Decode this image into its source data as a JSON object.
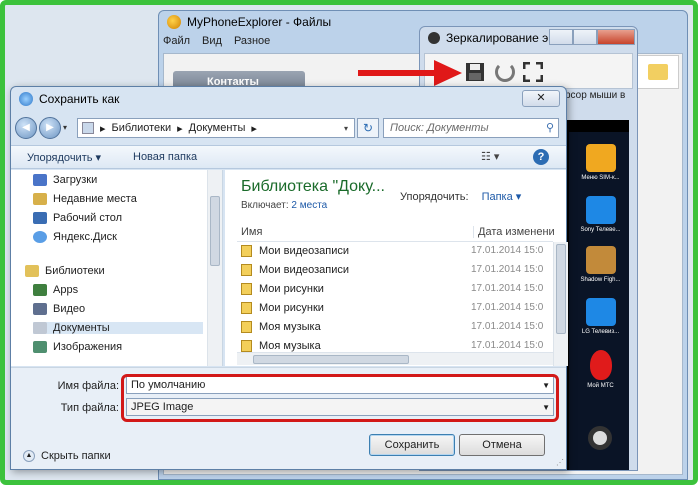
{
  "bg_window": {
    "title": "MyPhoneExplorer - Файлы",
    "menu": [
      "Файл",
      "Вид",
      "Разное"
    ],
    "contacts_button": "Контакты"
  },
  "mirror_window": {
    "title": "Зеркалирование э...",
    "cursor_text": "рсор мыши в",
    "phone_apps": [
      {
        "label": "Меню SIM-к...",
        "color": "#f0a820"
      },
      {
        "label": "Sony Телеве...",
        "color": "#1e88e5"
      },
      {
        "label": "Shadow Figh...",
        "color": "#c28a3a"
      },
      {
        "label": "LG Телевиз...",
        "color": "#1e88e5"
      },
      {
        "label": "Мой МТС",
        "color": "#e01b1b"
      }
    ]
  },
  "dialog": {
    "title": "Сохранить как",
    "close_label": "✕",
    "address": {
      "crumbs": [
        "Библиотеки",
        "Документы"
      ],
      "sep": "▸"
    },
    "search_placeholder": "Поиск: Документы",
    "commands": {
      "organize": "Упорядочить ▾",
      "new_folder": "Новая папка",
      "help": "?"
    },
    "nav_items": [
      {
        "label": "Загрузки",
        "color": "#4a74c8",
        "indent": false
      },
      {
        "label": "Недавние места",
        "color": "#d7b04a",
        "indent": false
      },
      {
        "label": "Рабочий стол",
        "color": "#3a6db3",
        "indent": false
      },
      {
        "label": "Яндекс.Диск",
        "color": "#5a9ee6",
        "indent": false
      },
      {
        "label": "Библиотеки",
        "color": "#e2c15a",
        "indent": true
      },
      {
        "label": "Apps",
        "color": "#3f7f3f",
        "indent": false
      },
      {
        "label": "Видео",
        "color": "#5f6f8f",
        "indent": false
      },
      {
        "label": "Документы",
        "color": "#c0c8d4",
        "indent": false,
        "selected": true
      },
      {
        "label": "Изображения",
        "color": "#4f8f6f",
        "indent": false
      }
    ],
    "library": {
      "title": "Библиотека \"Доку...",
      "includes_label": "Включает:",
      "includes_link": "2 места",
      "arrange_label": "Упорядочить:",
      "arrange_value": "Папка ▾"
    },
    "columns": {
      "name": "Имя",
      "date": "Дата изменени"
    },
    "files": [
      {
        "name": "Мои видеозаписи",
        "date": "17.01.2014 15:0"
      },
      {
        "name": "Мои видеозаписи",
        "date": "17.01.2014 15:0"
      },
      {
        "name": "Мои рисунки",
        "date": "17.01.2014 15:0"
      },
      {
        "name": "Мои рисунки",
        "date": "17.01.2014 15:0"
      },
      {
        "name": "Моя музыка",
        "date": "17.01.2014 15:0"
      },
      {
        "name": "Моя музыка",
        "date": "17.01.2014 15:0"
      }
    ],
    "filename_label": "Имя файла:",
    "filename_value": "По умолчанию",
    "filetype_label": "Тип файла:",
    "filetype_value": "JPEG Image",
    "hide_folders": "Скрыть папки",
    "save_button": "Сохранить",
    "cancel_button": "Отмена"
  }
}
